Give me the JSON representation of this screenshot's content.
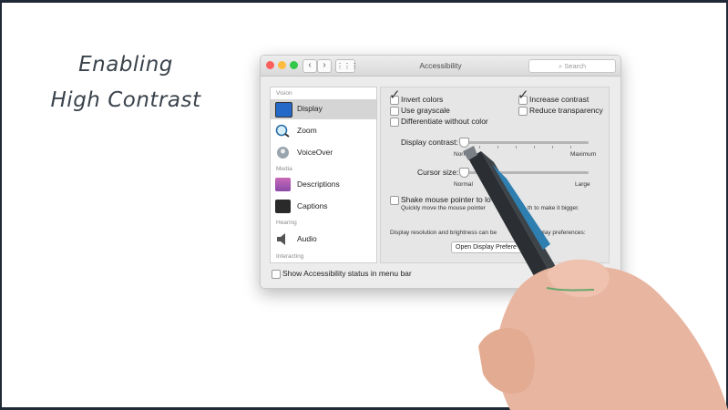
{
  "slide": {
    "title_line1": "Enabling",
    "title_line2": "High Contrast"
  },
  "window": {
    "title": "Accessibility",
    "search_placeholder": "Search",
    "nav_back": "‹",
    "nav_forward": "›",
    "grid_icon": "⋮⋮⋮"
  },
  "sidebar": {
    "sections": [
      "Vision",
      "Media",
      "Hearing",
      "Interacting"
    ],
    "items": [
      {
        "label": "Display",
        "icon": "display-icon",
        "selected": true
      },
      {
        "label": "Zoom",
        "icon": "zoom-icon",
        "selected": false
      },
      {
        "label": "VoiceOver",
        "icon": "voiceover-icon",
        "selected": false
      },
      {
        "label": "Descriptions",
        "icon": "descriptions-icon",
        "selected": false
      },
      {
        "label": "Captions",
        "icon": "captions-icon",
        "selected": false
      },
      {
        "label": "Audio",
        "icon": "speaker-icon",
        "selected": false
      }
    ]
  },
  "display": {
    "invert_colors": {
      "label": "Invert colors",
      "checked": true
    },
    "increase_contrast": {
      "label": "Increase contrast",
      "checked": true
    },
    "use_grayscale": {
      "label": "Use grayscale",
      "checked": false
    },
    "reduce_transparency": {
      "label": "Reduce transparency",
      "checked": false
    },
    "differentiate": {
      "label": "Differentiate without color",
      "checked": false
    },
    "display_contrast": {
      "label": "Display contrast:",
      "min_label": "Normal",
      "max_label": "Maximum",
      "level": 0
    },
    "cursor_size": {
      "label": "Cursor size:",
      "min_label": "Normal",
      "max_label": "Large",
      "level": 0
    },
    "shake": {
      "label": "Shake mouse pointer to lo",
      "desc": "Quickly move the mouse pointer",
      "desc_tail": "th to make it bigger.",
      "checked": false
    },
    "resolution_text": "Display resolution and brightness can be",
    "resolution_tail": "isplay preferences:",
    "open_prefs_button": "Open Display Prefere"
  },
  "footer": {
    "status_label": "Show Accessibility status in menu bar",
    "checked": false
  },
  "colors": {
    "frame": "#1f2a36",
    "title_ink": "#3a434c",
    "pen_body": "#2b2f33",
    "pen_accent": "#2e7fb0",
    "skin": "#e8b6a0"
  }
}
